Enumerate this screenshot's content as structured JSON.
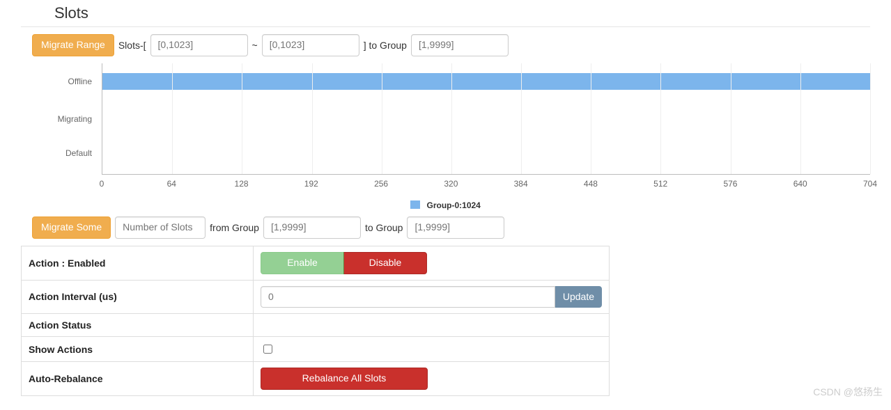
{
  "title": "Slots",
  "migrateRange": {
    "button": "Migrate Range",
    "prefix": "Slots-[",
    "fromPlaceholder": "[0,1023]",
    "sep": "~",
    "toPlaceholder": "[0,1023]",
    "suffix": "] to Group",
    "groupPlaceholder": "[1,9999]"
  },
  "migrateSome": {
    "button": "Migrate Some",
    "numPlaceholder": "Number of Slots",
    "fromLabel": "from Group",
    "fromPlaceholder": "[1,9999]",
    "toLabel": "to Group",
    "toPlaceholder": "[1,9999]"
  },
  "chart": {
    "yCategories": {
      "offline": "Offline",
      "migrating": "Migrating",
      "default": "Default"
    },
    "legend": "Group-0:1024"
  },
  "chart_data": {
    "type": "bar",
    "orientation": "horizontal",
    "categories": [
      "Offline",
      "Migrating",
      "Default"
    ],
    "values": [
      1024,
      0,
      0
    ],
    "xlim": [
      0,
      768
    ],
    "x_ticks": [
      0,
      64,
      128,
      192,
      256,
      320,
      384,
      448,
      512,
      576,
      640,
      704
    ],
    "series_name": "Group-0:1024",
    "title": "",
    "xlabel": "",
    "ylabel": ""
  },
  "config": {
    "actionLabel": "Action : Enabled",
    "enable": "Enable",
    "disable": "Disable",
    "intervalLabel": "Action Interval (us)",
    "intervalPlaceholder": "0",
    "update": "Update",
    "statusLabel": "Action Status",
    "statusValue": "",
    "showActionsLabel": "Show Actions",
    "autoRebalanceLabel": "Auto-Rebalance",
    "rebalanceBtn": "Rebalance All Slots"
  },
  "watermark": "CSDN @悠扬生"
}
